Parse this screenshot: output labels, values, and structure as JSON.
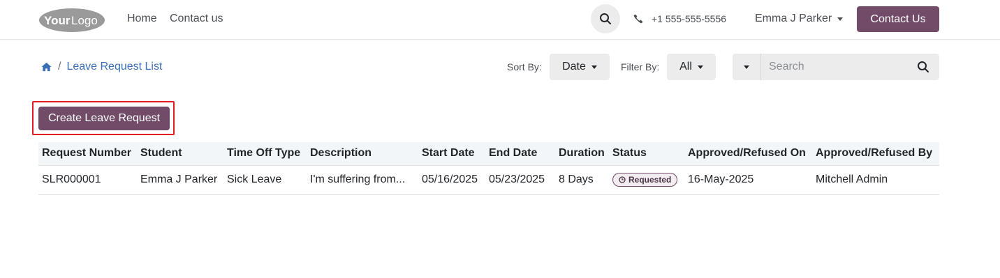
{
  "header": {
    "logo_text": "YourLogo",
    "nav": {
      "home": "Home",
      "contact": "Contact us"
    },
    "phone": "+1 555-555-5556",
    "user_name": "Emma J Parker",
    "contact_button": "Contact Us",
    "search_icon": "search-icon",
    "phone_icon": "phone-icon"
  },
  "breadcrumb": {
    "home_icon": "home-icon",
    "separator": "/",
    "current": "Leave Request List"
  },
  "controls": {
    "sort_label": "Sort By:",
    "sort_value": "Date",
    "filter_label": "Filter By:",
    "filter_value": "All",
    "search_placeholder": "Search"
  },
  "create_button": "Create Leave Request",
  "table": {
    "headers": [
      "Request Number",
      "Student",
      "Time Off Type",
      "Description",
      "Start Date",
      "End Date",
      "Duration",
      "Status",
      "Approved/Refused On",
      "Approved/Refused By"
    ],
    "rows": [
      {
        "request_number": "SLR000001",
        "student": "Emma J Parker",
        "time_off_type": "Sick Leave",
        "description": "I'm suffering from...",
        "start_date": "05/16/2025",
        "end_date": "05/23/2025",
        "duration": "8 Days",
        "status": "Requested",
        "approved_on": "16-May-2025",
        "approved_by": "Mitchell Admin"
      }
    ]
  },
  "colors": {
    "brand": "#714b67",
    "link": "#3b6fb5",
    "highlight": "#e11d1d"
  }
}
